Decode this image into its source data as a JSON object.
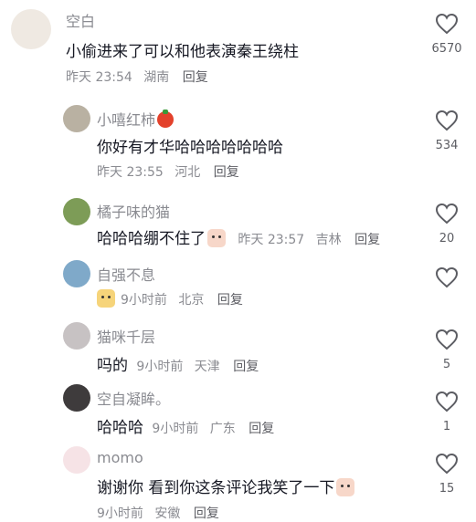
{
  "comments": [
    {
      "username": "空白",
      "text": "小偷进来了可以和他表演秦王绕柱",
      "time": "昨天 23:54",
      "location": "湖南",
      "reply": "回复",
      "likes": "6570"
    },
    {
      "username": "小嘻红柿",
      "text": "你好有才华哈哈哈哈哈哈哈",
      "time": "昨天 23:55",
      "location": "河北",
      "reply": "回复",
      "likes": "534"
    },
    {
      "username": "橘子味的猫",
      "text": "哈哈哈绷不住了",
      "time": "昨天 23:57",
      "location": "吉林",
      "reply": "回复",
      "likes": "20"
    },
    {
      "username": "自强不息",
      "text": "",
      "time": "9小时前",
      "location": "北京",
      "reply": "回复",
      "likes": ""
    },
    {
      "username": "猫咪千层",
      "text": "吗的",
      "time": "9小时前",
      "location": "天津",
      "reply": "回复",
      "likes": "5"
    },
    {
      "username": "空自凝眸。",
      "text": "哈哈哈",
      "time": "9小时前",
      "location": "广东",
      "reply": "回复",
      "likes": "1"
    },
    {
      "username": "momo",
      "text": "谢谢你 看到你这条评论我笑了一下",
      "time": "9小时前",
      "location": "安徽",
      "reply": "回复",
      "likes": "15"
    }
  ],
  "icons": {
    "like": "heart-outline-icon",
    "tomato": "tomato-emoji-icon",
    "sticker": "sticker-emoji-icon"
  }
}
